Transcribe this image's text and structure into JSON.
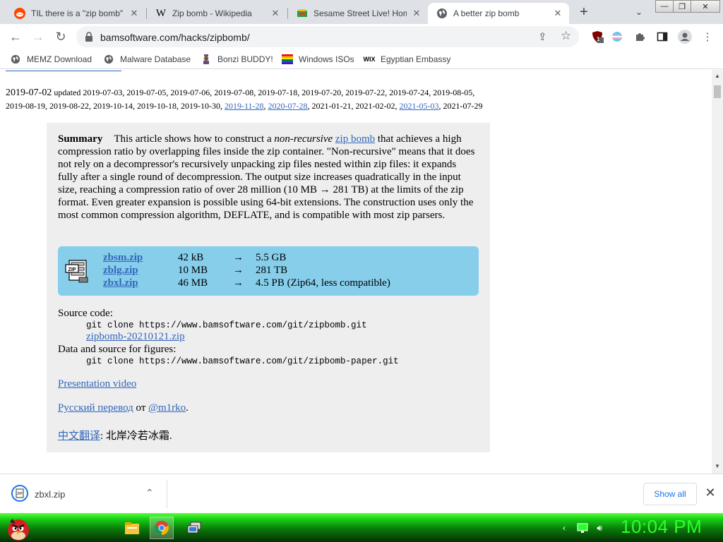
{
  "tabs": [
    {
      "title": "TIL there is a \"zip bomb\"",
      "icon": "reddit-icon"
    },
    {
      "title": "Zip bomb - Wikipedia",
      "icon": "wikipedia-icon"
    },
    {
      "title": "Sesame Street Live! Home",
      "icon": "sesame-street-icon"
    },
    {
      "title": "A better zip bomb",
      "icon": "globe-icon"
    }
  ],
  "omnibox": {
    "url": "bamsoftware.com/hacks/zipbomb/"
  },
  "extensions": {
    "badge_count": "1"
  },
  "bookmarks": [
    {
      "label": "MEMZ Download",
      "icon": "globe-icon"
    },
    {
      "label": "Malware Database",
      "icon": "globe-icon"
    },
    {
      "label": "Bonzi BUDDY!",
      "icon": "bonzi-icon"
    },
    {
      "label": "Windows ISOs",
      "icon": "windows-flag-icon"
    },
    {
      "label": "Egyptian Embassy",
      "icon": "wix-icon"
    }
  ],
  "page": {
    "dates": {
      "first": "2019-07-02",
      "updated_label": "updated",
      "line1": "2019-07-03, 2019-07-05, 2019-07-06, 2019-07-08, 2019-07-18, 2019-07-20, 2019-07-22, 2019-07-24, 2019-08-05,",
      "line2_start": "2019-08-19, 2019-08-22, 2019-10-14, 2019-10-18, 2019-10-30, ",
      "link1": "2019-11-28",
      "link2": "2020-07-28",
      "mid": ", 2021-01-21, 2021-02-02, ",
      "link3": "2021-05-03",
      "end": ", 2021-07-29"
    },
    "summary": {
      "label": "Summary",
      "p1": "This article shows how to construct a ",
      "em": "non-recursive",
      "link": "zip bomb",
      "p2": " that achieves a high compression ratio by overlapping files inside the zip container. \"Non-recursive\" means that it does not rely on a decompressor's recursively unpacking zip files nested within zip files: it expands fully after a single round of decompression. The output size increases quadratically in the input size, reaching a compression ratio of over 28 million (10 MB → 281 TB) at the limits of the zip format. Even greater expansion is possible using 64-bit extensions. The construction uses only the most common compression algorithm, DEFLATE, and is compatible with most zip parsers."
    },
    "downloads": [
      {
        "name": "zbsm.zip",
        "size": "42 kB",
        "arrow": "→",
        "output": "5.5 GB"
      },
      {
        "name": "zblg.zip",
        "size": "10 MB",
        "arrow": "→",
        "output": "281 TB"
      },
      {
        "name": "zbxl.zip",
        "size": "46 MB",
        "arrow": "→",
        "output": "4.5 PB (Zip64, less compatible)"
      }
    ],
    "zip_icon_text": "ZIP",
    "source_label": "Source code:",
    "source_cmd": "git clone https://www.bamsoftware.com/git/zipbomb.git",
    "source_zip": "zipbomb-20210121.zip",
    "figures_label": "Data and source for figures:",
    "figures_cmd": "git clone https://www.bamsoftware.com/git/zipbomb-paper.git",
    "video_link": "Presentation video",
    "russian_link": "Русский перевод",
    "russian_from": " от ",
    "russian_author": "@m1rko",
    "russian_end": ".",
    "chinese_link": "中文翻译",
    "chinese_rest": ": 北岸冷若冰霜."
  },
  "download_shelf": {
    "file_name": "zbxl.zip",
    "show_all": "Show all"
  },
  "taskbar": {
    "clock": "10:04 PM"
  },
  "colors": {
    "link": "#3366bb",
    "summary_bg": "#eeeeee",
    "download_box": "#87ceeb",
    "taskbar_green": "#17d017",
    "clock": "#2cff2c"
  }
}
